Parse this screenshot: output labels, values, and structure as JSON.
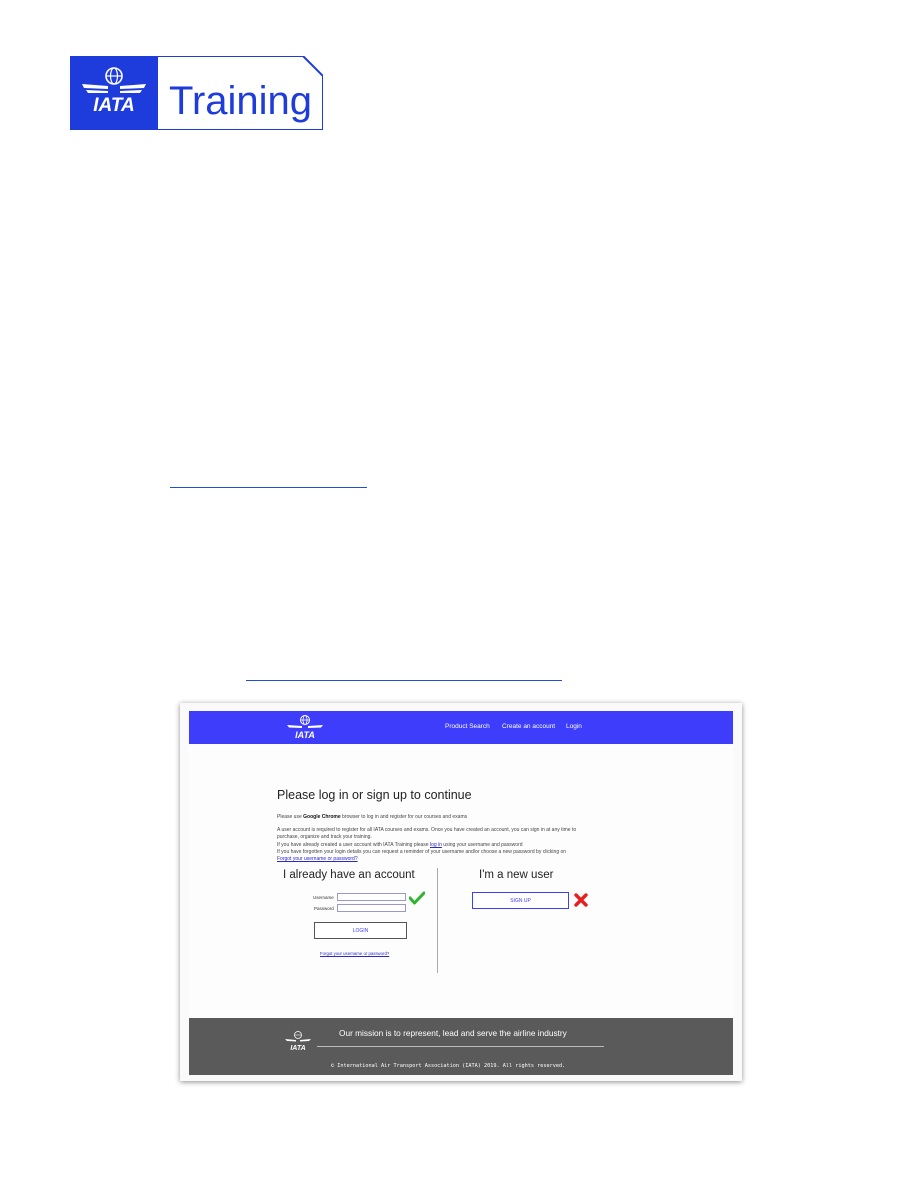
{
  "logo": {
    "acronym": "IATA",
    "product": "Training"
  },
  "screenshot": {
    "header": {
      "logo_text": "IATA",
      "nav": [
        "Product Search",
        "Create an account",
        "Login"
      ]
    },
    "title": "Please log in or sign up to continue",
    "chrome_note": {
      "prefix": "Please use ",
      "bold": "Google Chrome",
      "suffix": " browser to log in and register for our courses and exams"
    },
    "info_lines": [
      "A user account is required to register for all IATA courses and exams. Once you have created an account, you can sign in at any time to",
      "purchase, organize and track your training."
    ],
    "login_line": {
      "prefix": "If you have already created a user account with IATA Training please ",
      "link": "log in",
      "suffix": " using your username and password"
    },
    "forgot_line": "If you have forgotten your login details you can request a reminder of your username and/or choose a new password by clicking on",
    "forgot_link": "Forgot your username or password?",
    "left_column": {
      "title": "I already have an account",
      "username_label": "Username",
      "password_label": "Password",
      "login_button": "LOGIN",
      "forgot_link": "Forgot your username or password?"
    },
    "right_column": {
      "title": "I'm a new user",
      "signup_button": "SIGN UP"
    },
    "footer": {
      "logo_text": "IATA",
      "mission": "Our mission is to represent, lead and serve the airline industry",
      "copyright": "© International Air Transport Association (IATA) 2019. All rights reserved."
    },
    "markers": {
      "login_mark": "checkmark-icon",
      "signup_mark": "cross-icon"
    }
  },
  "colors": {
    "brand_blue": "#3d3dfb",
    "footer_gray": "#5a5a5a",
    "check_green": "#2db52d",
    "cross_red": "#e52020"
  }
}
